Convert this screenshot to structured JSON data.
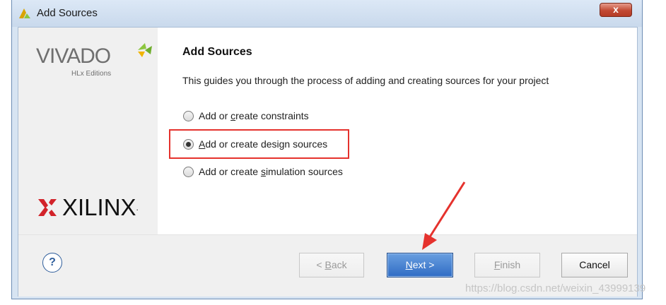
{
  "window": {
    "title": "Add Sources",
    "close_label": "x"
  },
  "branding": {
    "product": "VIVADO",
    "edition": "HLx Editions",
    "vendor": "XILINX"
  },
  "page": {
    "heading": "Add Sources",
    "description": "This guides you through the process of adding and creating sources for your project"
  },
  "options": [
    {
      "label_pre": "Add or ",
      "label_u": "c",
      "label_post": "reate constraints",
      "selected": false
    },
    {
      "label_pre": "",
      "label_u": "A",
      "label_post": "dd or create design sources",
      "selected": true
    },
    {
      "label_pre": "Add or create ",
      "label_u": "s",
      "label_post": "imulation sources",
      "selected": false
    }
  ],
  "buttons": {
    "help": "?",
    "back_prefix": "< ",
    "back_u": "B",
    "back_rest": "ack",
    "next_u": "N",
    "next_rest": "ext >",
    "finish_u": "F",
    "finish_rest": "inish",
    "cancel": "Cancel"
  },
  "watermark": "https://blog.csdn.net/weixin_43999139",
  "colors": {
    "highlight": "#e5322d",
    "arrow": "#e5322d",
    "primary_button": "#2f6cc4",
    "vivado_leaf": "#8cc63f"
  }
}
